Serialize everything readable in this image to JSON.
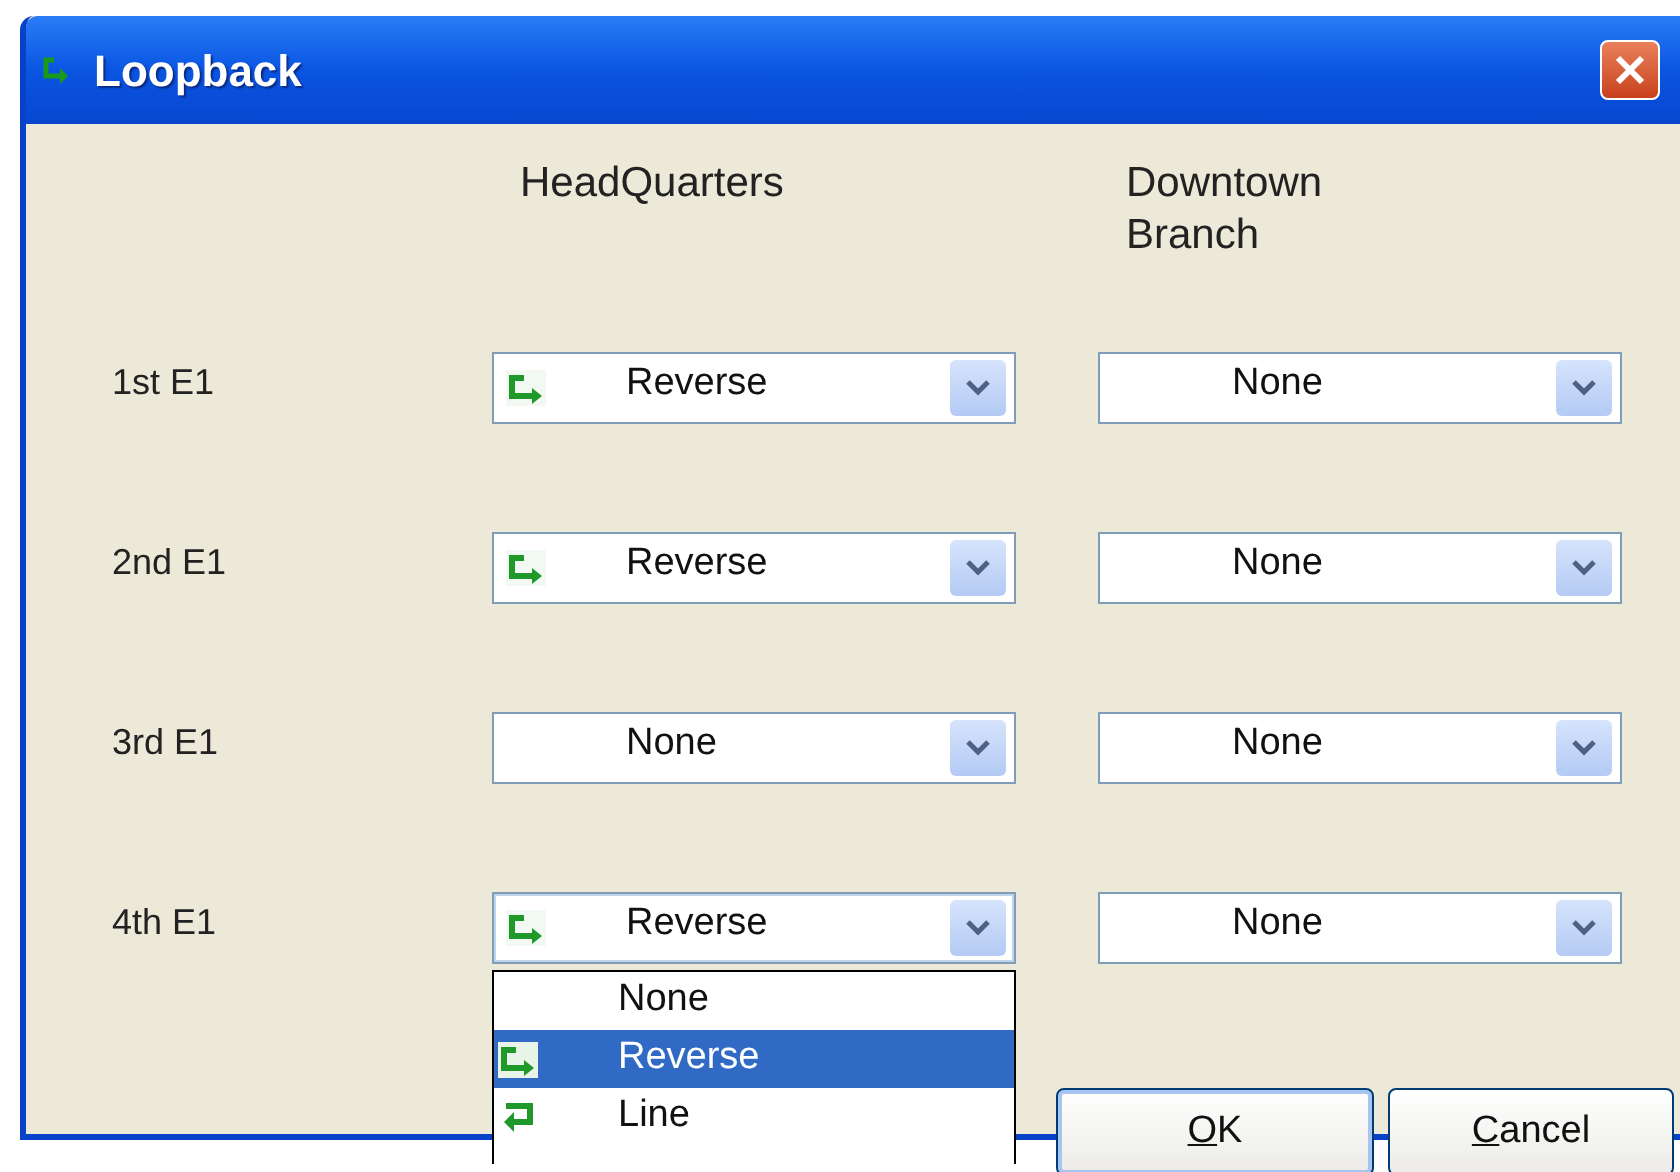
{
  "window": {
    "title": "Loopback"
  },
  "columns": [
    {
      "heading": "HeadQuarters"
    },
    {
      "heading": "Downtown Branch"
    }
  ],
  "rows": [
    {
      "label": "1st E1",
      "cells": [
        {
          "value": "Reverse",
          "kind": "reverse",
          "expanded": false
        },
        {
          "value": "None",
          "kind": "none",
          "expanded": false
        }
      ]
    },
    {
      "label": "2nd E1",
      "cells": [
        {
          "value": "Reverse",
          "kind": "reverse",
          "expanded": false
        },
        {
          "value": "None",
          "kind": "none",
          "expanded": false
        }
      ]
    },
    {
      "label": "3rd E1",
      "cells": [
        {
          "value": "None",
          "kind": "none",
          "expanded": false
        },
        {
          "value": "None",
          "kind": "none",
          "expanded": false
        }
      ]
    },
    {
      "label": "4th E1",
      "cells": [
        {
          "value": "Reverse",
          "kind": "reverse",
          "expanded": true,
          "options": [
            {
              "label": "None",
              "kind": "none",
              "selected": false
            },
            {
              "label": "Reverse",
              "kind": "reverse",
              "selected": true
            },
            {
              "label": "Line",
              "kind": "line",
              "selected": false
            }
          ]
        },
        {
          "value": "None",
          "kind": "none",
          "expanded": false
        }
      ]
    }
  ],
  "buttons": [
    {
      "label": "OK",
      "default": true,
      "underline_first": true
    },
    {
      "label": "Cancel",
      "default": false,
      "underline_first": true
    }
  ]
}
